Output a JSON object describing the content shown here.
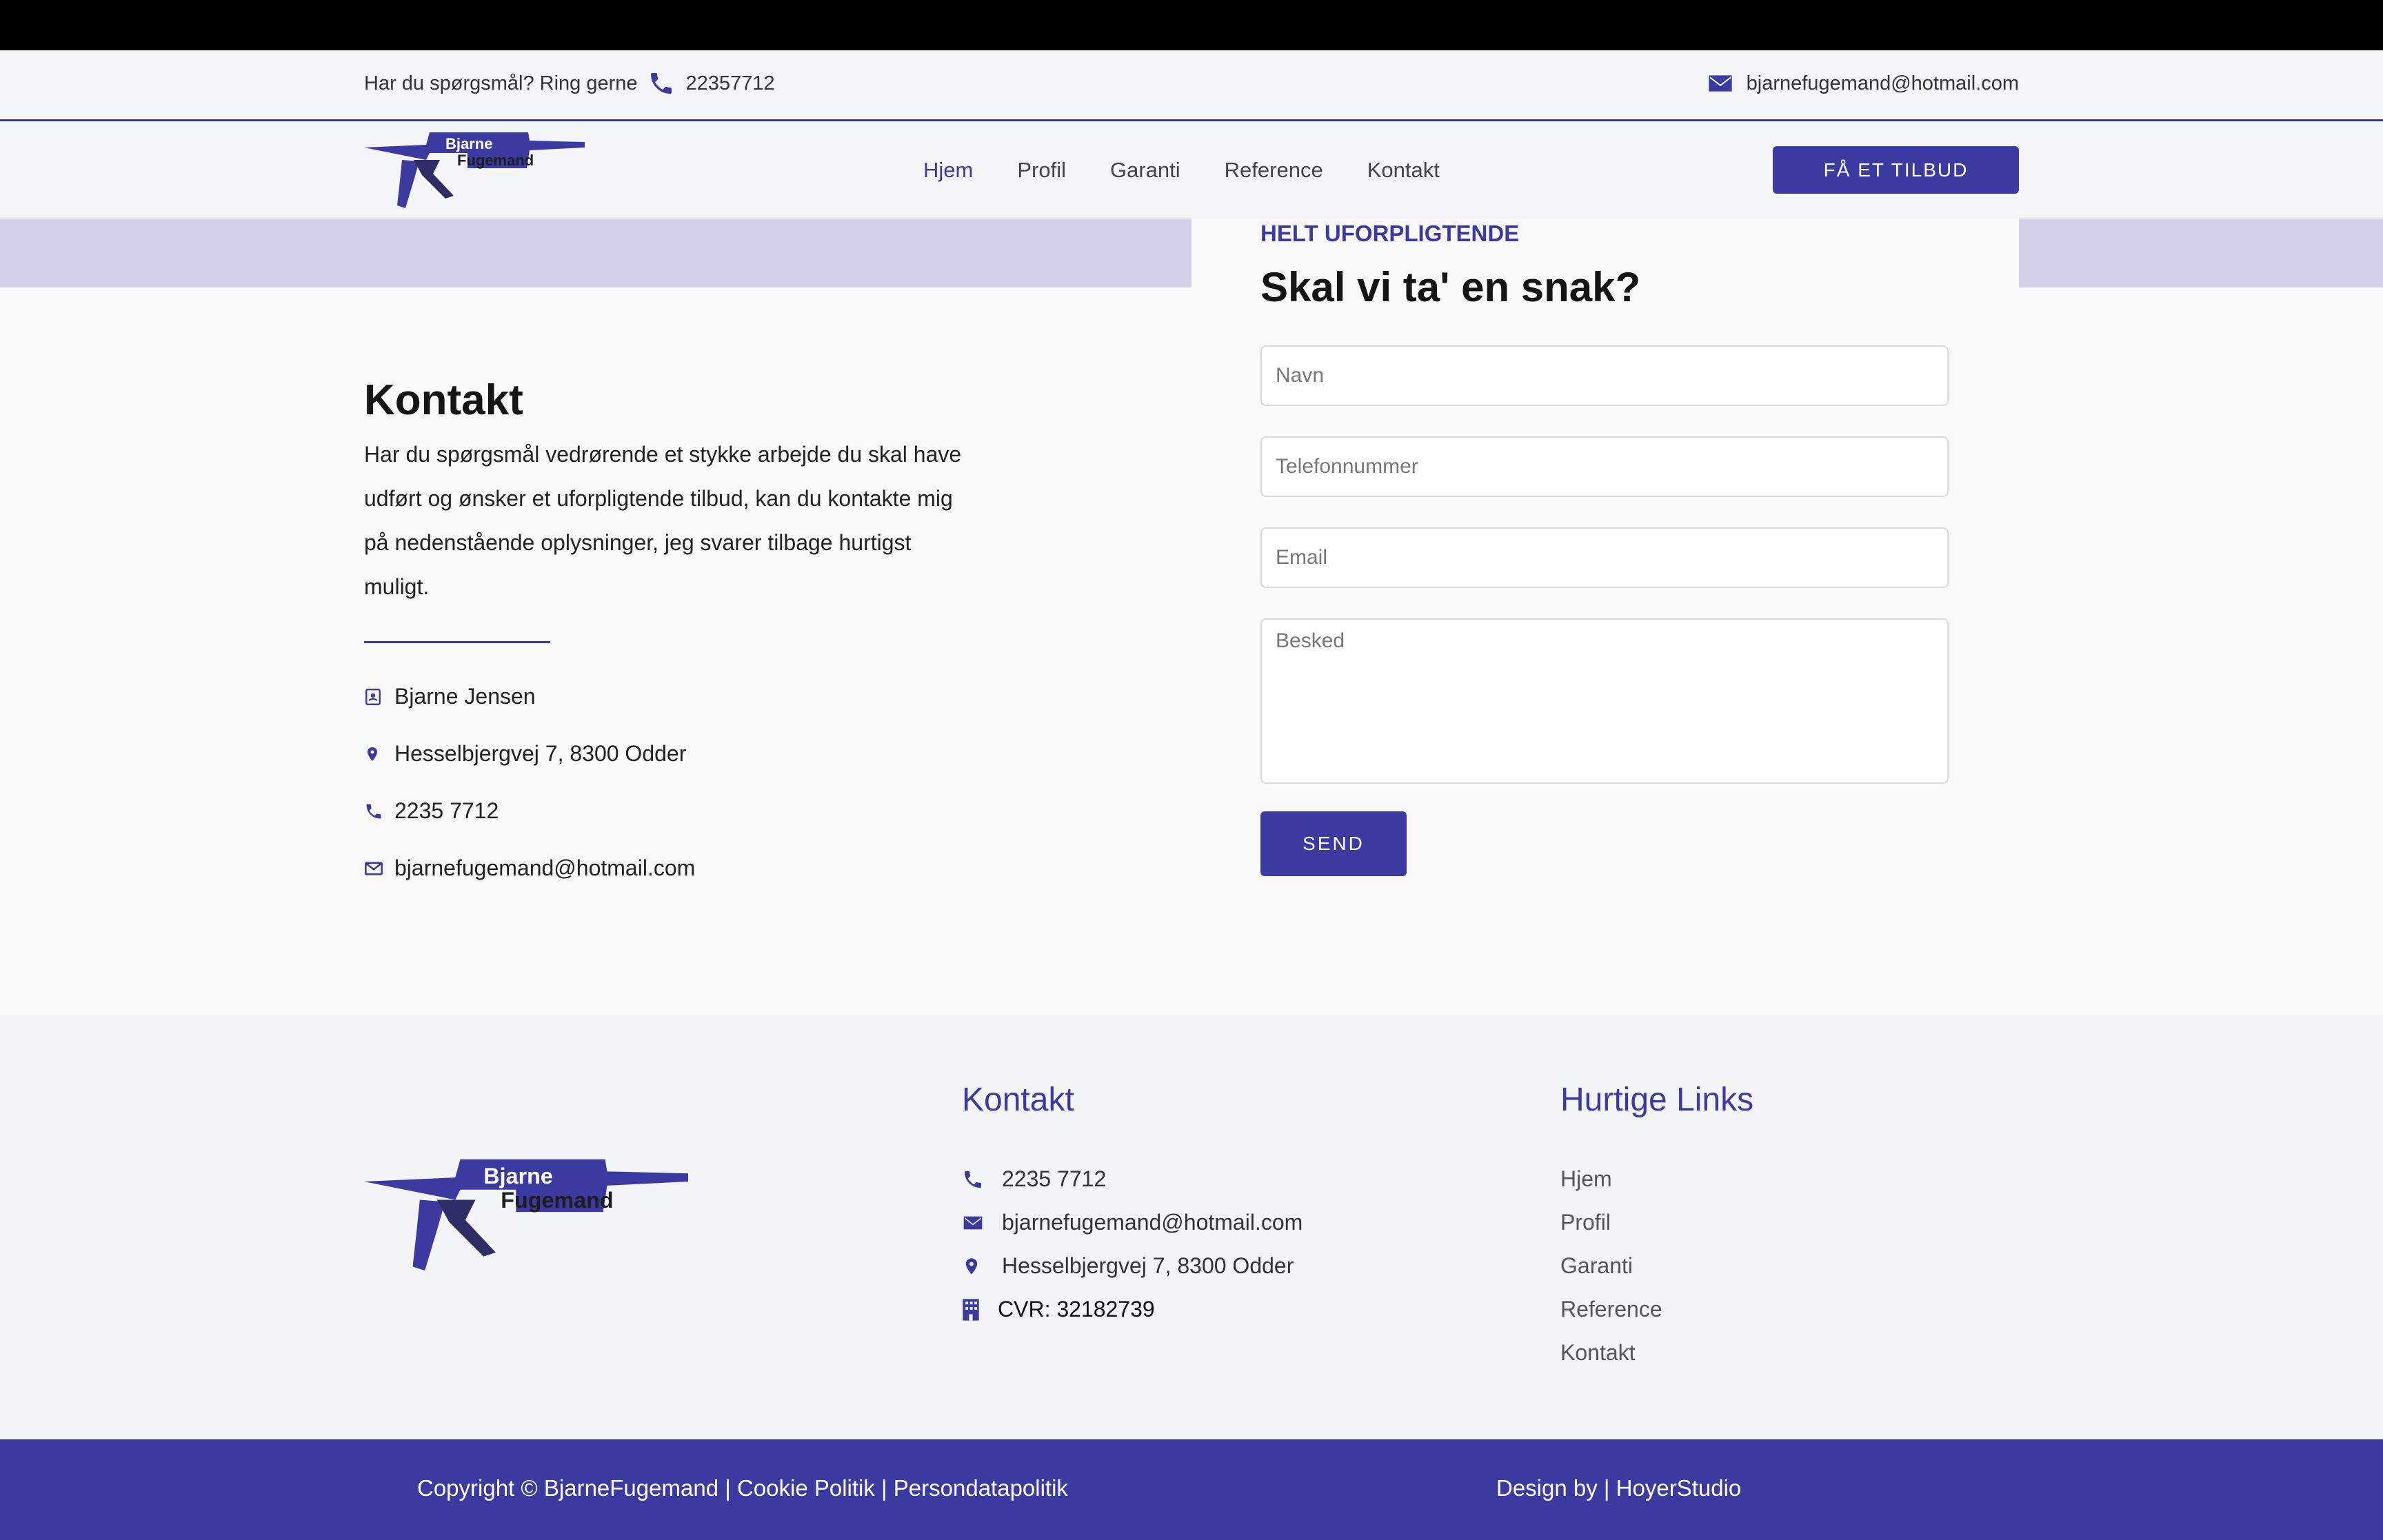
{
  "topbar": {
    "question": "Har du spørgsmål? Ring gerne",
    "phone": "22357712",
    "email": "bjarnefugemand@hotmail.com"
  },
  "logo": {
    "line1": "Bjarne",
    "line2": "Fugemand"
  },
  "nav": {
    "items": [
      {
        "label": "Hjem"
      },
      {
        "label": "Profil"
      },
      {
        "label": "Garanti"
      },
      {
        "label": "Reference"
      },
      {
        "label": "Kontakt"
      }
    ],
    "cta": "FÅ ET TILBUD"
  },
  "contact": {
    "title": "Kontakt",
    "description": "Har du spørgsmål vedrørende et stykke arbejde du skal have udført og ønsker et uforpligtende tilbud, kan du kontakte mig på nedenstående oplysninger, jeg svarer tilbage hurtigst muligt.",
    "name": "Bjarne Jensen",
    "address": "Hesselbjergvej 7, 8300 Odder",
    "phone": "2235 7712",
    "email": "bjarnefugemand@hotmail.com"
  },
  "form": {
    "kicker": "HELT UFORPLIGTENDE",
    "title": "Skal vi ta' en snak?",
    "name_placeholder": "Navn",
    "phone_placeholder": "Telefonnummer",
    "email_placeholder": "Email",
    "message_placeholder": "Besked",
    "send": "SEND"
  },
  "footer": {
    "contact_heading": "Kontakt",
    "phone": "2235 7712",
    "email": "bjarnefugemand@hotmail.com",
    "address": "Hesselbjergvej 7, 8300 Odder",
    "cvr": "CVR: 32182739",
    "links_heading": "Hurtige Links",
    "links": [
      "Hjem",
      "Profil",
      "Garanti",
      "Reference",
      "Kontakt"
    ]
  },
  "bottom": {
    "copyright": "Copyright © BjarneFugemand | Cookie Politik | Persondatapolitik",
    "design": "Design by | HoyerStudio"
  },
  "colors": {
    "accent": "#3c3aa0",
    "lavender": "#cfd0e8",
    "dark": "#2e2d66"
  }
}
